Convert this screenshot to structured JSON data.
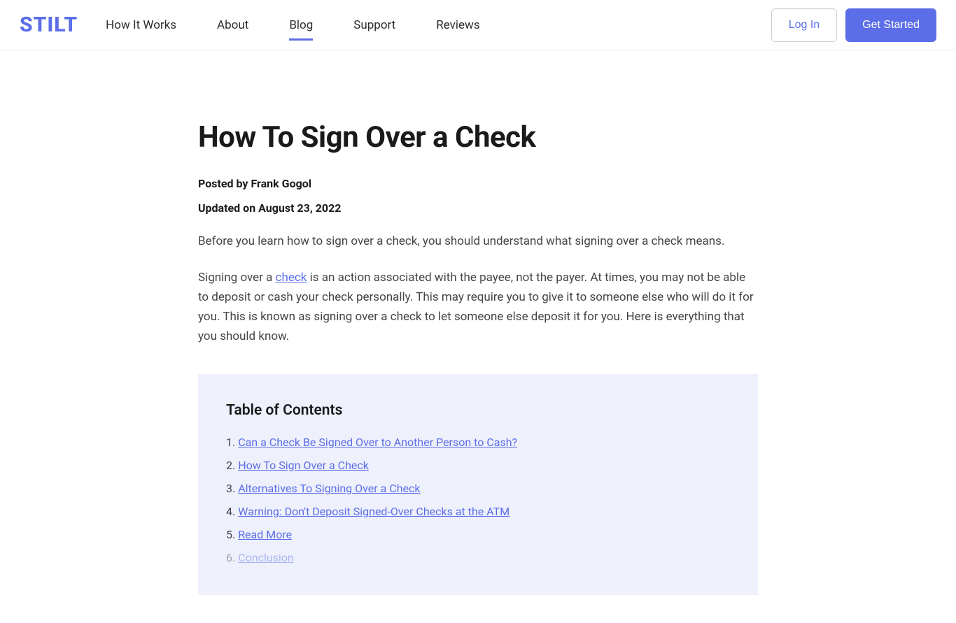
{
  "header": {
    "logo": "STILT",
    "nav": [
      {
        "label": "How It Works",
        "active": false
      },
      {
        "label": "About",
        "active": false
      },
      {
        "label": "Blog",
        "active": true
      },
      {
        "label": "Support",
        "active": false
      },
      {
        "label": "Reviews",
        "active": false
      }
    ],
    "login": "Log In",
    "get_started": "Get Started"
  },
  "article": {
    "title": "How To Sign Over a Check",
    "byline": "Posted by Frank Gogol",
    "updated": "Updated on August 23, 2022",
    "intro1": "Before you learn how to sign over a check, you should understand what signing over a check means.",
    "intro2_pre": "Signing over a ",
    "intro2_link": "check",
    "intro2_post": " is an action associated with the payee, not the payer. At times, you may not be able to deposit or cash your check personally. This may require you to give it to someone else who will do it for you. This is known as signing over a check to let someone else deposit it for you. Here is everything that you should know."
  },
  "toc": {
    "heading": "Table of Contents",
    "items": [
      "Can a Check Be Signed Over to Another Person to Cash?",
      "How To Sign Over a Check",
      "Alternatives To Signing Over a Check",
      "Warning: Don't Deposit Signed-Over Checks at the ATM",
      "Read More",
      "Conclusion"
    ]
  }
}
